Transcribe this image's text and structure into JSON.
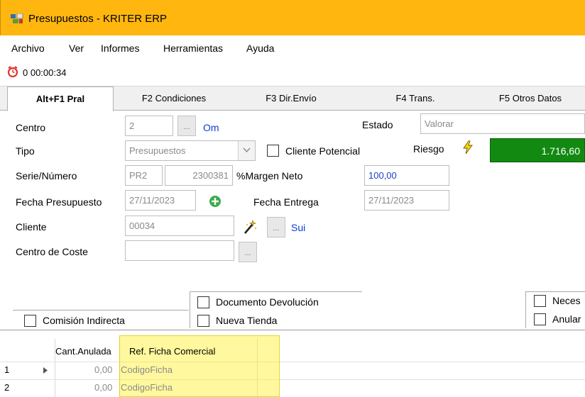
{
  "window": {
    "title": "Presupuestos - KRITER ERP"
  },
  "menu": [
    "Archivo",
    "Ver",
    "Informes",
    "Herramientas",
    "Ayuda"
  ],
  "timer": "0 00:00:34",
  "tabs": [
    "Alt+F1 Pral",
    "F2 Condiciones",
    "F3 Dir.Envío",
    "F4 Trans.",
    "F5 Otros Datos"
  ],
  "form": {
    "centro": {
      "label": "Centro",
      "value": "2",
      "link": "Om"
    },
    "estado": {
      "label": "Estado",
      "value": "Valorar"
    },
    "tipo": {
      "label": "Tipo",
      "value": "Presupuestos"
    },
    "cliente_potencial": {
      "label": "Cliente Potencial",
      "checked": false
    },
    "riesgo": {
      "label": "Riesgo",
      "value": "1.716,60",
      "color": "#128a12"
    },
    "serie_numero": {
      "label": "Serie/Número",
      "serie": "PR2",
      "numero": "2300381"
    },
    "margen_neto": {
      "label": "%Margen Neto",
      "value": "100,00"
    },
    "fecha_presupuesto": {
      "label": "Fecha Presupuesto",
      "value": "27/11/2023"
    },
    "fecha_entrega": {
      "label": "Fecha Entrega",
      "value": "27/11/2023"
    },
    "cliente": {
      "label": "Cliente",
      "value": "00034",
      "link": "Sui"
    },
    "centro_coste": {
      "label": "Centro de Coste",
      "value": ""
    },
    "documento_devolucion": {
      "label": "Documento Devolución",
      "checked": false
    },
    "nueva_tienda": {
      "label": "Nueva Tienda",
      "checked": false
    },
    "comision_indirecta": {
      "label": "Comisión Indirecta",
      "checked": false
    },
    "neces": {
      "label": "Neces",
      "checked": false
    },
    "anular": {
      "label": "Anular",
      "checked": false
    }
  },
  "grid": {
    "columns": [
      "Cant.Anulada",
      "Ref. Ficha Comercial"
    ],
    "rows": [
      {
        "num": "1",
        "cant": "0,00",
        "ref": "CodigoFicha"
      },
      {
        "num": "2",
        "cant": "0,00",
        "ref": "CodigoFicha"
      }
    ]
  }
}
